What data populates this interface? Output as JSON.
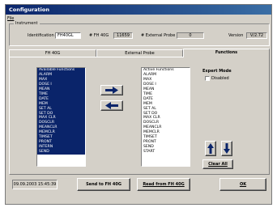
{
  "window": {
    "title": "Configuration"
  },
  "menu": {
    "file": "File"
  },
  "instrument": {
    "legend": "Instrument",
    "identification_label": "Identification",
    "identification_value": "FH40GL",
    "fh400_label": "# FH 40G",
    "fh400_value": "11659",
    "external_probe_label": "# External Probe",
    "external_probe_value": "0",
    "version_label": "Version",
    "version_value": "V/2.72"
  },
  "tabs": [
    {
      "label": "FH 40G"
    },
    {
      "label": "External Probe"
    },
    {
      "label": "Functions"
    }
  ],
  "available": {
    "header": "Available Functions",
    "items": [
      "ALARM",
      "MAX",
      "DOSE I",
      "MEAN",
      "TIME",
      "DATE",
      "MEM",
      "SET AL",
      "SET DO",
      "MAX CLR",
      "DOSCLR",
      "MEANCLR",
      "MEMCLR",
      "TIMSET",
      "PRONT",
      "INTERN",
      "SEND"
    ]
  },
  "active": {
    "header": "Active Functions",
    "items": [
      "ALARM",
      "MAX",
      "DOSE I",
      "MEAN",
      "TIME",
      "DATE",
      "MEM",
      "SET AL",
      "SET DO",
      "MAX CLR",
      "DOSCLR",
      "MEANCLR",
      "MEMCLR",
      "TIMSET",
      "PRONT",
      "SEND",
      "START"
    ]
  },
  "expert": {
    "title": "Expert Mode",
    "checkbox_label": "Disabled",
    "checked": false
  },
  "buttons": {
    "clear_all": "Clear All",
    "send": "Send to FH 40G",
    "read": "Read from FH 40G",
    "ok": "OK"
  },
  "status": {
    "datetime": "09.09.2003 15:45:39"
  },
  "colors": {
    "title_bar": "#0a246a",
    "selection": "#0a246a",
    "arrow": "#0a246a"
  }
}
